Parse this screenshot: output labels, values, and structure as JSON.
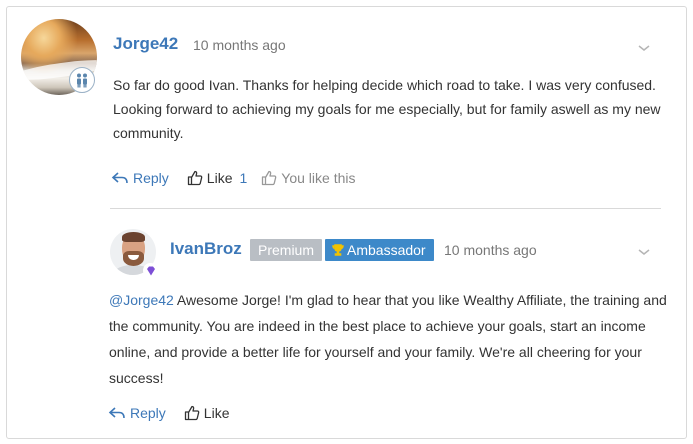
{
  "comment": {
    "username": "Jorge42",
    "time": "10 months ago",
    "body": "So far do good Ivan. Thanks for helping decide which road to take. I was very confused. Looking forward to achieving my goals for me especially, but for family aswell as my new community.",
    "actions": {
      "reply_label": "Reply",
      "like_label": "Like",
      "like_count": "1",
      "you_like_label": "You like this"
    },
    "badge_icon": "family-icon"
  },
  "reply": {
    "username": "IvanBroz",
    "tag_premium": "Premium",
    "tag_ambassador": "Ambassador",
    "time": "10 months ago",
    "mention": "@Jorge42",
    "body": " Awesome Jorge! I'm glad to hear that you like Wealthy Affiliate, the training and the community. You are indeed in the best place to achieve your goals, start an income online, and provide a better life for yourself and your family. We're all cheering for your success!",
    "actions": {
      "reply_label": "Reply",
      "like_label": "Like"
    },
    "badge_icon": "diamond-icon"
  },
  "colors": {
    "link": "#3d78b8",
    "premium_tag": "#b9bec4",
    "ambassador_tag": "#3d89c9",
    "trophy": "#f2c200",
    "diamond": "#7d4fd6"
  }
}
